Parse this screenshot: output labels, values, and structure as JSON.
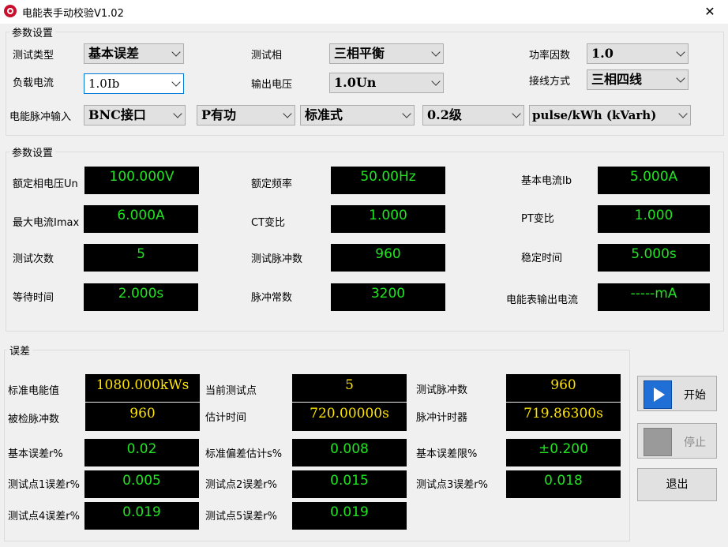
{
  "window": {
    "title": "电能表手动校验V1.02",
    "close_glyph": "✕"
  },
  "params_group": {
    "title": "参数设置",
    "test_type": {
      "label": "测试类型",
      "value": "基本误差"
    },
    "test_phase": {
      "label": "测试相",
      "value": "三相平衡"
    },
    "power_factor": {
      "label": "功率因数",
      "value": "1.0"
    },
    "load_current": {
      "label": "负载电流",
      "value": "1.0Ib"
    },
    "output_voltage": {
      "label": "输出电压",
      "value": "1.0Un"
    },
    "wiring": {
      "label": "接线方式",
      "value": "三相四线"
    },
    "pulse_input": {
      "label": "电能脉冲输入",
      "port": "BNC接口",
      "power_kind": "P有功",
      "standard": "标准式",
      "grade": "0.2级",
      "unit": "pulse/kWh (kVarh)"
    }
  },
  "settings_group": {
    "title": "参数设置",
    "rated_voltage": {
      "label": "额定相电压Un",
      "value": "100.000V"
    },
    "rated_freq": {
      "label": "额定频率",
      "value": "50.00Hz"
    },
    "base_current": {
      "label": "基本电流Ib",
      "value": "5.000A"
    },
    "max_current": {
      "label": "最大电流Imax",
      "value": "6.000A"
    },
    "ct_ratio": {
      "label": "CT变比",
      "value": "1.000"
    },
    "pt_ratio": {
      "label": "PT变比",
      "value": "1.000"
    },
    "test_count": {
      "label": "测试次数",
      "value": "5"
    },
    "test_pulses": {
      "label": "测试脉冲数",
      "value": "960"
    },
    "settle_time": {
      "label": "稳定时间",
      "value": "5.000s"
    },
    "wait_time": {
      "label": "等待时间",
      "value": "2.000s"
    },
    "pulse_const": {
      "label": "脉冲常数",
      "value": "3200"
    },
    "meter_out_current": {
      "label": "电能表输出电流",
      "value": "-----mA"
    }
  },
  "error_group": {
    "title": "误差",
    "std_energy": {
      "label": "标准电能值",
      "value": "1080.000kWs"
    },
    "current_point": {
      "label": "当前测试点",
      "value": "5"
    },
    "test_pulses": {
      "label": "测试脉冲数",
      "value": "960"
    },
    "checked_pulses": {
      "label": "被检脉冲数",
      "value": "960"
    },
    "est_time": {
      "label": "估计时间",
      "value": "720.00000s"
    },
    "pulse_timer": {
      "label": "脉冲计时器",
      "value": "719.86300s"
    },
    "base_error": {
      "label": "基本误差r%",
      "value": "0.02"
    },
    "std_dev": {
      "label": "标准偏差估计s%",
      "value": "0.008"
    },
    "error_limit": {
      "label": "基本误差限%",
      "value": "±0.200"
    },
    "p1": {
      "label": "测试点1误差r%",
      "value": "0.005"
    },
    "p2": {
      "label": "测试点2误差r%",
      "value": "0.015"
    },
    "p3": {
      "label": "测试点3误差r%",
      "value": "0.018"
    },
    "p4": {
      "label": "测试点4误差r%",
      "value": "0.019"
    },
    "p5": {
      "label": "测试点5误差r%",
      "value": "0.019"
    }
  },
  "buttons": {
    "start": "开始",
    "stop": "停止",
    "exit": "退出"
  },
  "colors": {
    "green_text": "#21e321",
    "yellow_text": "#ffe400",
    "play_blue": "#1f6fd6"
  }
}
